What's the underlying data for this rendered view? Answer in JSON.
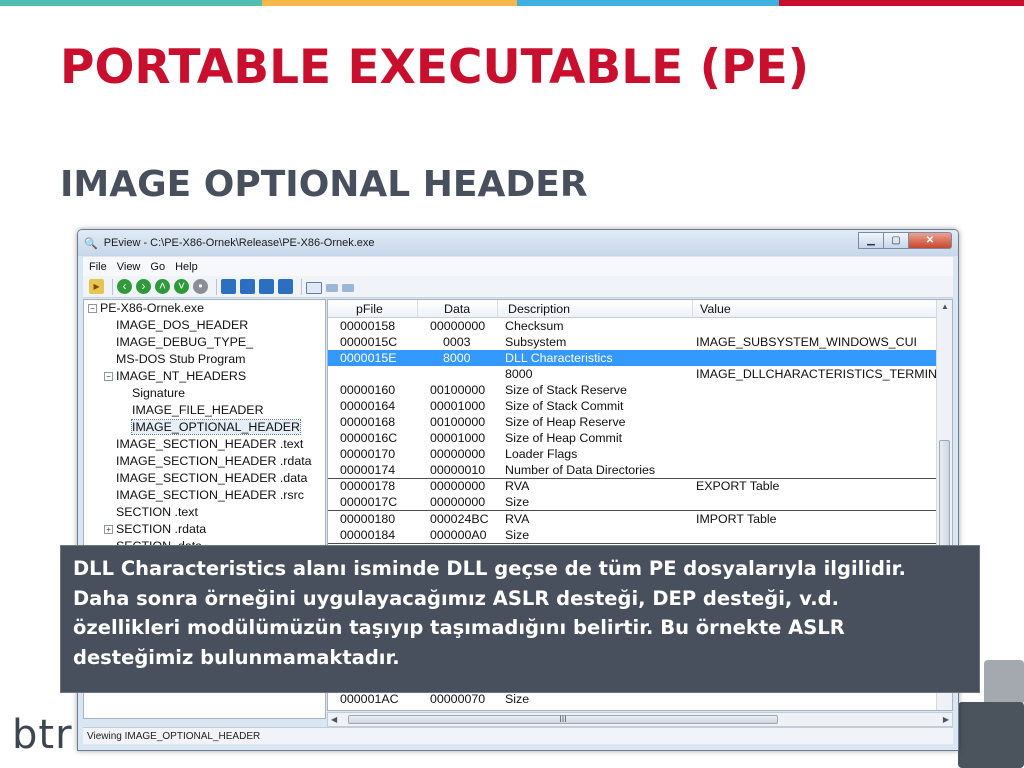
{
  "slide": {
    "title": "PORTABLE EXECUTABLE (PE)",
    "subtitle": "IMAGE OPTIONAL HEADER",
    "logo_text": "btr",
    "top_bar_colors": [
      "#4fbdb0",
      "#f5b84a",
      "#3eb1e2",
      "#c8102e"
    ],
    "title_color": "#c8102e",
    "subtitle_color": "#47505c"
  },
  "window": {
    "title": "PEview - C:\\PE-X86-Ornek\\Release\\PE-X86-Ornek.exe",
    "app_icon": "magnifier-icon",
    "buttons": {
      "minimize": "▁",
      "maximize": "▢",
      "close": "✕"
    }
  },
  "menu": [
    {
      "label": "File"
    },
    {
      "label": "View"
    },
    {
      "label": "Go"
    },
    {
      "label": "Help"
    }
  ],
  "tree": [
    {
      "label": "PE-X86-Ornek.exe",
      "expander": "−"
    },
    {
      "label": "IMAGE_DOS_HEADER"
    },
    {
      "label": "IMAGE_DEBUG_TYPE_"
    },
    {
      "label": "MS-DOS Stub Program"
    },
    {
      "label": "IMAGE_NT_HEADERS",
      "expander": "−"
    },
    {
      "label": "Signature"
    },
    {
      "label": "IMAGE_FILE_HEADER"
    },
    {
      "label": "IMAGE_OPTIONAL_HEADER",
      "selected": true
    },
    {
      "label": "IMAGE_SECTION_HEADER .text"
    },
    {
      "label": "IMAGE_SECTION_HEADER .rdata"
    },
    {
      "label": "IMAGE_SECTION_HEADER .data"
    },
    {
      "label": "IMAGE_SECTION_HEADER .rsrc"
    },
    {
      "label": "SECTION .text"
    },
    {
      "label": "SECTION .rdata",
      "expander": "+"
    },
    {
      "label": "SECTION .data"
    }
  ],
  "list": {
    "columns": [
      "pFile",
      "Data",
      "Description",
      "Value"
    ],
    "rows": [
      {
        "pfile": "00000158",
        "data": "00000000",
        "desc": "Checksum",
        "value": ""
      },
      {
        "pfile": "0000015C",
        "data": "0003",
        "desc": "Subsystem",
        "value": "IMAGE_SUBSYSTEM_WINDOWS_CUI"
      },
      {
        "pfile": "0000015E",
        "data": "8000",
        "desc": "DLL Characteristics",
        "value": "",
        "selected": true
      },
      {
        "pfile": "",
        "data": "",
        "desc": "8000",
        "value": "IMAGE_DLLCHARACTERISTICS_TERMINA"
      },
      {
        "pfile": "00000160",
        "data": "00100000",
        "desc": "Size of Stack Reserve",
        "value": ""
      },
      {
        "pfile": "00000164",
        "data": "00001000",
        "desc": "Size of Stack Commit",
        "value": ""
      },
      {
        "pfile": "00000168",
        "data": "00100000",
        "desc": "Size of Heap Reserve",
        "value": ""
      },
      {
        "pfile": "0000016C",
        "data": "00001000",
        "desc": "Size of Heap Commit",
        "value": ""
      },
      {
        "pfile": "00000170",
        "data": "00000000",
        "desc": "Loader Flags",
        "value": ""
      },
      {
        "pfile": "00000174",
        "data": "00000010",
        "desc": "Number of Data Directories",
        "value": ""
      },
      {
        "pfile": "00000178",
        "data": "00000000",
        "desc": "RVA",
        "value": "EXPORT Table"
      },
      {
        "pfile": "0000017C",
        "data": "00000000",
        "desc": "Size",
        "value": ""
      },
      {
        "pfile": "00000180",
        "data": "000024BC",
        "desc": "RVA",
        "value": "IMPORT Table"
      },
      {
        "pfile": "00000184",
        "data": "000000A0",
        "desc": "Size",
        "value": ""
      },
      {
        "pfile": "000001AC",
        "data": "00000070",
        "desc": "Size",
        "value": ""
      }
    ]
  },
  "scroll": {
    "hthumb_label": "III"
  },
  "status": "Viewing IMAGE_OPTIONAL_HEADER",
  "caption": {
    "lines": [
      "DLL Characteristics alanı isminde DLL geçse de tüm PE dosyalarıyla ilgilidir.",
      "Daha sonra örneğini uygulayacağımız ASLR desteği, DEP desteği, v.d.",
      "özellikleri modülümüzün taşıyıp taşımadığını belirtir. Bu örnekte ASLR",
      "desteğimiz bulunmamaktadır."
    ]
  }
}
